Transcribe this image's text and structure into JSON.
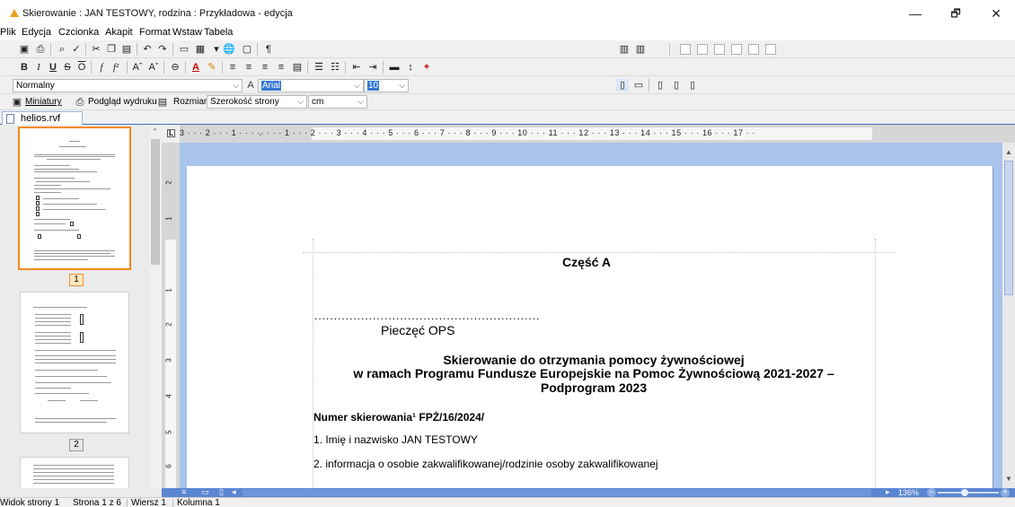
{
  "window": {
    "title": "Skierowanie : JAN TESTOWY, rodzina : Przykładowa - edycja",
    "minimize": "—",
    "maximize": "🗗",
    "close": "✕"
  },
  "menu": [
    "Plik",
    "Edycja",
    "Czcionka",
    "Akapit",
    "Format",
    "Wstaw",
    "Tabela"
  ],
  "toolbar": {
    "style_value": "Normalny",
    "font_value": "Arial",
    "size_value": "10",
    "thumbnails_label": "Miniatury",
    "print_preview_label": "Podgląd wydruku",
    "size_label": "Rozmiar",
    "page_width_value": "Szerokość strony",
    "unit_value": "cm"
  },
  "file_tab": "helios.rvf",
  "thumbnails": {
    "page_numbers": [
      "1",
      "2"
    ]
  },
  "ruler": {
    "h_labels": "3 · · · 2 · · · 1 · · · ⌵ · · · 1 · · · 2 · · · 3 · · · 4 · · · 5 · · · 6 · · · 7 · · · 8 · · · 9 · · · 10 · · · 11 · · · 12 · · · 13 · · · 14 · · · 15 · · · 16 · · · 17 · ·",
    "v_labels": [
      "2",
      "1",
      "1",
      "2",
      "3",
      "4",
      "5",
      "6"
    ]
  },
  "document": {
    "heading": "Część  A",
    "dots": "..........................................................",
    "stamp": "Pieczęć OPS",
    "title_line1": "Skierowanie  do otrzymania pomocy żywnościowej",
    "title_line2": "w ramach Programu Fundusze Europejskie na Pomoc Żywnościową 2021-2027 –",
    "title_line3": "Podprogram 2023",
    "ref_number": "Numer skierowania¹ FPŻ/16/2024/",
    "item1": "1. Imię i nazwisko JAN TESTOWY",
    "item2": "2. informacja o osobie zakwalifikowanej/rodzinie osoby zakwalifikowanej"
  },
  "zoom": "136%",
  "status": {
    "view": "Widok strony 1",
    "page": "Strona 1 z 6",
    "row": "Wiersz 1",
    "column": "Kolumna 1"
  }
}
